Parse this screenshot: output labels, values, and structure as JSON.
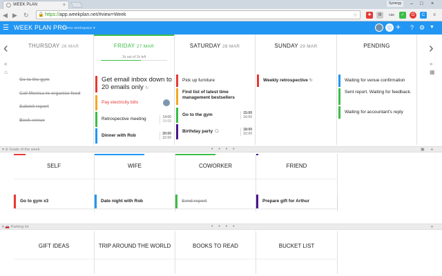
{
  "browser": {
    "tab_title": "WEEK PLAN",
    "tab_close": "×",
    "user_badge": "Synergy",
    "win_min": "–",
    "win_max": "□",
    "win_close": "×",
    "url_https": "https://",
    "url_rest": "app.weekplan.net/#view=Week",
    "star_icon": "☆",
    "ext_css": "css"
  },
  "app": {
    "menu_icon": "☰",
    "title": "WEEK PLAN PRO",
    "subtitle": "Demo workspace ▾",
    "add_icon": "+",
    "help_icon": "?",
    "settings_icon": "⚙",
    "filter_icon": "▼",
    "accent": "#2196f3"
  },
  "nav": {
    "prev_arrow": "‹",
    "next_arrow": "›",
    "rewind_icon": "«",
    "home_icon": "⌂",
    "forward_icon": "»",
    "calendar_icon": "▦"
  },
  "days": [
    {
      "name": "THURSDAY",
      "date": "26 MAR",
      "tasks": [
        {
          "text": "Go to the gym",
          "done": true
        },
        {
          "text": "Call Monica to organize food",
          "done": true
        },
        {
          "text": "Submit report",
          "done": true
        },
        {
          "text": "Book venue",
          "done": true
        }
      ]
    },
    {
      "name": "FRIDAY",
      "date": "27 MAR",
      "today": true,
      "progress_note": "1h out of 1h left",
      "progress": 0.6,
      "tasks": [
        {
          "text": "Get email inbox down to 20 emails only",
          "color": "#e53935"
        },
        {
          "text": "Pay electricity bills",
          "color": "#f6a623"
        },
        {
          "text": "Retrospective meeting",
          "color": "#3cbc47",
          "start": "14:00",
          "end": "15:00"
        },
        {
          "text": "Dinner with Rob",
          "color": "#2196f3",
          "start": "20:00",
          "end": "22:00"
        }
      ]
    },
    {
      "name": "SATURDAY",
      "date": "28 MAR",
      "tasks": [
        {
          "text": "Pick up furniture",
          "color": "#e53935"
        },
        {
          "text": "Find list of latest time management bestsellers",
          "color": "#f6a623"
        },
        {
          "text": "Go to the gym",
          "color": "#3cbc47",
          "start": "15:00",
          "end": "16:00"
        },
        {
          "text": "Birthday party",
          "color": "#4a148c",
          "start": "18:00",
          "end": "22:00"
        }
      ]
    },
    {
      "name": "SUNDAY",
      "date": "29 MAR",
      "tasks": [
        {
          "text": "Weekly retrospective",
          "color": "#e53935"
        }
      ]
    },
    {
      "name": "PENDING",
      "date": "",
      "tasks": [
        {
          "text": "Waiting for venue confirmation",
          "color": "#2196f3"
        },
        {
          "text": "Sent report. Waiting for feedback.",
          "color": "#3cbc47"
        },
        {
          "text": "Waiting for accountant's reply",
          "color": "#3cbc47"
        }
      ]
    }
  ],
  "goals": {
    "label": "▾ ⊘ Goals of the week",
    "dots": "• • • •",
    "columns": [
      {
        "title": "SELF",
        "color": "#e53935",
        "task": "Go to gym x3",
        "done": false
      },
      {
        "title": "WIFE",
        "color": "#2196f3",
        "task": "Date night with Rob",
        "done": false
      },
      {
        "title": "COWORKER",
        "color": "#3cbc47",
        "task": "Send report",
        "done": true
      },
      {
        "title": "FRIEND",
        "color": "#4a148c",
        "task": "Prepare gift for Arthur",
        "done": false
      }
    ]
  },
  "parking": {
    "label": "▾ 🚗 Parking lot",
    "dots": "• • • •",
    "columns": [
      "GIFT IDEAS",
      "TRIP AROUND THE WORLD",
      "BOOKS TO READ",
      "BUCKET LIST"
    ]
  }
}
